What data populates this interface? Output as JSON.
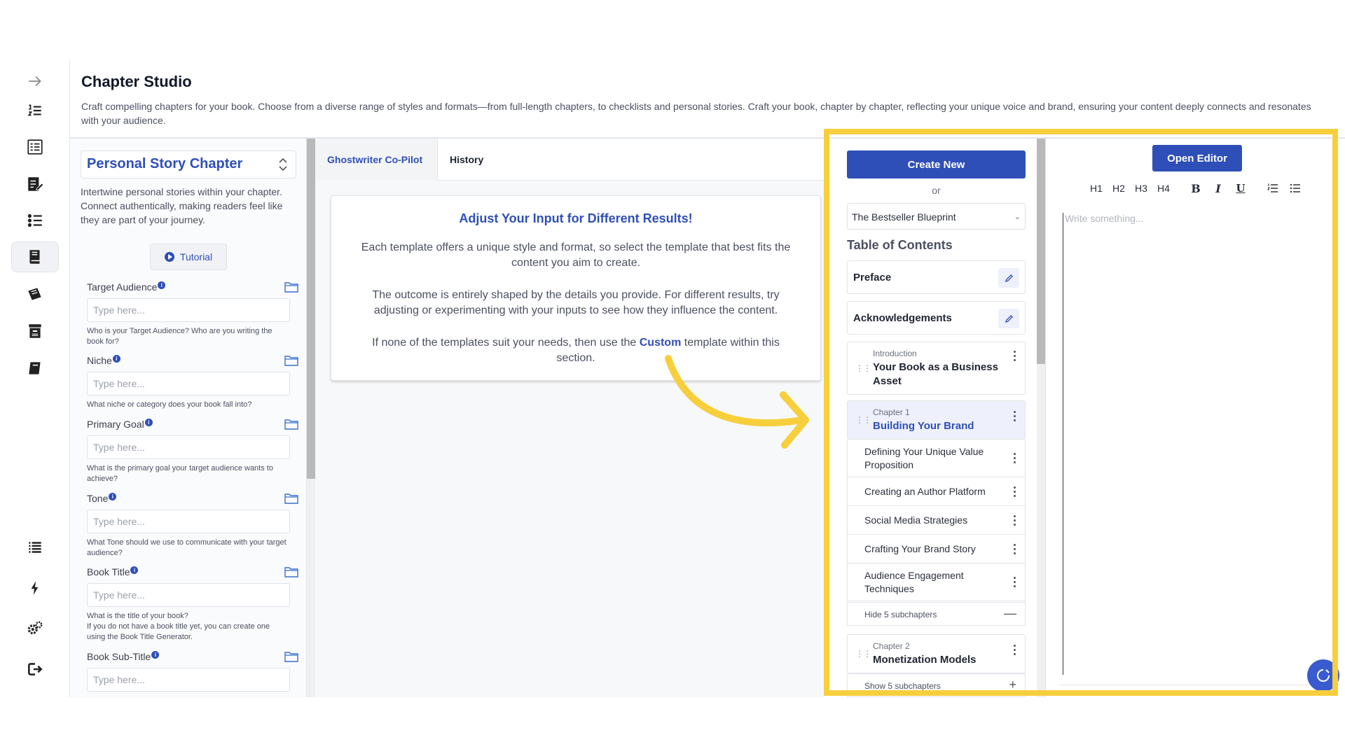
{
  "header": {
    "title": "Chapter Studio",
    "description": "Craft compelling chapters for your book. Choose from a diverse range of styles and formats—from full-length chapters, to checklists and personal stories. Craft your book, chapter by chapter, reflecting your unique voice and brand, ensuring your content deeply connects and resonates with your audience."
  },
  "nav": {
    "items": [
      "arrow-right-icon",
      "numbered-list-icon",
      "document-list-icon",
      "edit-document-icon",
      "bullet-list-icon",
      "book-stack-icon",
      "books-icon",
      "archive-icon",
      "book-icon",
      "list-icon",
      "bolt-icon",
      "settings-icon",
      "logout-icon"
    ],
    "active_index": 5
  },
  "left": {
    "template_title": "Personal Story Chapter",
    "template_desc": "Intertwine personal stories within your chapter. Connect authentically, making readers feel like they are part of your journey.",
    "tutorial_label": "Tutorial",
    "fields": [
      {
        "label": "Target Audience",
        "placeholder": "Type here...",
        "help": "Who is your Target Audience? Who are you writing the book for?"
      },
      {
        "label": "Niche",
        "placeholder": "Type here...",
        "help": "What niche or category does your book fall into?"
      },
      {
        "label": "Primary Goal",
        "placeholder": "Type here...",
        "help": "What is the primary goal your target audience wants to achieve?"
      },
      {
        "label": "Tone",
        "placeholder": "Type here...",
        "help": "What Tone should we use to communicate with your target audience?"
      },
      {
        "label": "Book Title",
        "placeholder": "Type here...",
        "help": "What is the title of your book?",
        "help2": "If you do not have a book title yet, you can create one using the Book Title Generator."
      },
      {
        "label": "Book Sub-Title",
        "placeholder": "Type here...",
        "help": ""
      }
    ]
  },
  "middle": {
    "tabs": [
      "Ghostwriter Co-Pilot",
      "History"
    ],
    "notice_title": "Adjust Your Input for Different Results!",
    "p1": "Each template offers a unique style and format, so select the template that best fits the content you aim to create.",
    "p2": "The outcome is entirely shaped by the details you provide. For different results, try adjusting or experimenting with your inputs to see how they influence the content.",
    "p3_before": "If none of the templates suit your needs, then use the ",
    "p3_link": "Custom",
    "p3_after": " template within this section."
  },
  "toc": {
    "create_label": "Create New",
    "or_label": "or",
    "book_selected": "The Bestseller Blueprint",
    "title": "Table of Contents",
    "preface": "Preface",
    "acknowledgements": "Acknowledgements",
    "intro_kind": "Introduction",
    "intro_name": "Your Book as a Business Asset",
    "ch1_kind": "Chapter 1",
    "ch1_name": "Building Your Brand",
    "ch1_subs": [
      "Defining Your Unique Value Proposition",
      "Creating an Author Platform",
      "Social Media Strategies",
      "Crafting Your Brand Story",
      "Audience Engagement Techniques"
    ],
    "hide_label": "Hide 5 subchapters",
    "ch2_kind": "Chapter 2",
    "ch2_name": "Monetization Models",
    "show_label": "Show 5 subchapters"
  },
  "editor": {
    "open_label": "Open Editor",
    "placeholder": "Write something...",
    "headings": [
      "H1",
      "H2",
      "H3",
      "H4"
    ],
    "bold": "B",
    "italic": "I",
    "underline": "U"
  },
  "colors": {
    "accent": "#2f4fb8",
    "highlight": "#f7cf3d"
  }
}
